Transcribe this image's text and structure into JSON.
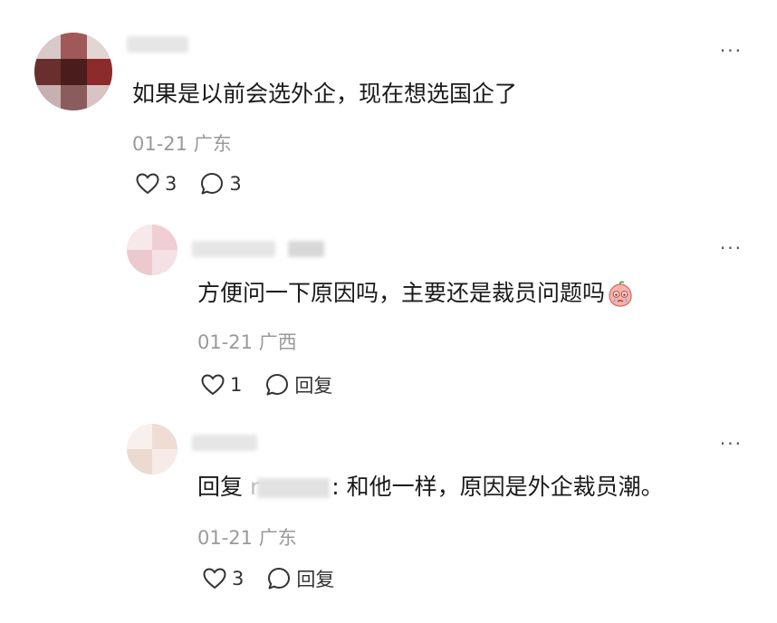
{
  "comments": [
    {
      "text": "如果是以前会选外企，现在想选国企了",
      "date": "01-21",
      "location": "广东",
      "likes": "3",
      "replies": "3",
      "more_icon": "more-dots-icon"
    },
    {
      "text": "方便问一下原因吗，主要还是裁员问题吗",
      "emoji": "crying-peach-emoji",
      "date": "01-21",
      "location": "广西",
      "likes": "1",
      "reply_label": "回复",
      "more_icon": "more-dots-icon"
    },
    {
      "reply_prefix": "回复 ",
      "mention": "r",
      "text": ": 和他一样，原因是外企裁员潮。",
      "date": "01-21",
      "location": "广东",
      "likes": "3",
      "reply_label": "回复",
      "more_icon": "more-dots-icon"
    }
  ],
  "more_glyph": "···",
  "colors": {
    "text": "#1a1a1a",
    "meta": "#9a9a9a",
    "icon": "#333333",
    "background": "#ffffff"
  }
}
